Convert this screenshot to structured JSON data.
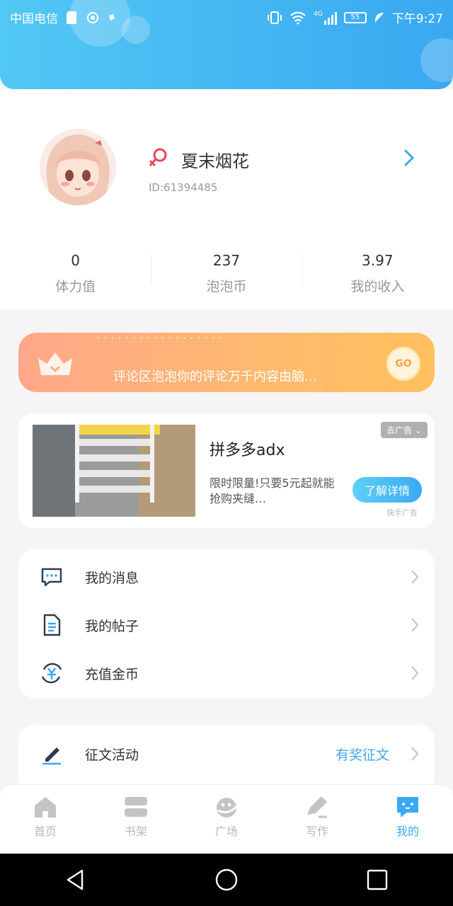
{
  "status_bar": {
    "carrier": "中国电信",
    "time": "下午9:27",
    "network": "4G",
    "battery": "55"
  },
  "profile": {
    "nickname": "夏末烟花",
    "id_text": "ID:61394485",
    "gender_icon": "female-icon"
  },
  "stats": [
    {
      "value": "0",
      "label": "体力值"
    },
    {
      "value": "237",
      "label": "泡泡币"
    },
    {
      "value": "3.97",
      "label": "我的收入"
    }
  ],
  "vip_banner": {
    "marquee_text": "评论区泡泡你的评论万千内容由脑…",
    "go_label": "GO"
  },
  "ad": {
    "title": "拼多多adx",
    "description": "限时限量!只要5元起就能抢购夹缝…",
    "tag": "去广告",
    "cta": "了解详情",
    "source": "快手广告"
  },
  "menu": [
    {
      "label": "我的消息",
      "icon": "message-icon"
    },
    {
      "label": "我的帖子",
      "icon": "document-icon"
    },
    {
      "label": "充值金币",
      "icon": "coin-icon"
    }
  ],
  "menu2": [
    {
      "label": "征文活动",
      "icon": "pen-icon",
      "extra": "有奖征文"
    }
  ],
  "tabs": [
    {
      "label": "首页",
      "icon": "home-icon",
      "active": false
    },
    {
      "label": "书架",
      "icon": "bookshelf-icon",
      "active": false
    },
    {
      "label": "广场",
      "icon": "square-icon",
      "active": false
    },
    {
      "label": "写作",
      "icon": "write-icon",
      "active": false
    },
    {
      "label": "我的",
      "icon": "chat-bubble-icon",
      "active": true
    }
  ],
  "colors": {
    "accent": "#3aa9f3",
    "header_start": "#52c8f4",
    "header_end": "#39a8f1",
    "vip_start": "#ffa78a",
    "vip_end": "#ffc05e",
    "female": "#e4475a"
  }
}
